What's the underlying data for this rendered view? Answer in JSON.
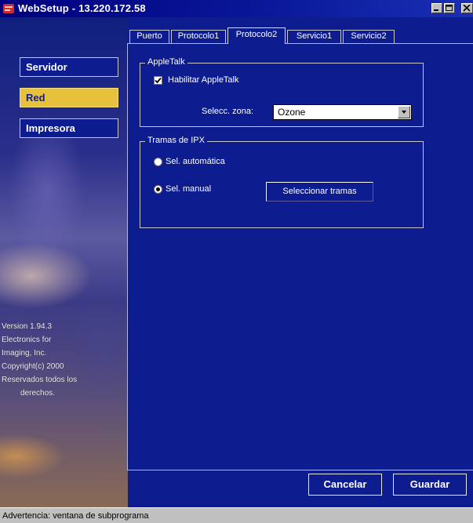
{
  "window": {
    "title": "WebSetup - 13.220.172.58",
    "controls": [
      "minimize-icon",
      "maximize-icon",
      "close-icon"
    ]
  },
  "sidebar": {
    "items": [
      {
        "label": "Servidor",
        "active": false
      },
      {
        "label": "Red",
        "active": true
      },
      {
        "label": "Impresora",
        "active": false
      }
    ],
    "version_lines": [
      "Version 1.94.3",
      "Electronics for",
      "Imaging, Inc.",
      "Copyright(c) 2000",
      "Reservados todos los",
      "derechos."
    ]
  },
  "tabs": [
    {
      "label": "Puerto",
      "active": false
    },
    {
      "label": "Protocolo1",
      "active": false
    },
    {
      "label": "Protocolo2",
      "active": true
    },
    {
      "label": "Servicio1",
      "active": false
    },
    {
      "label": "Servicio2",
      "active": false
    }
  ],
  "appletalk": {
    "group_title": "AppleTalk",
    "enable_label": "Habilitar AppleTalk",
    "enable_checked": true,
    "zone_label": "Selecc. zona:",
    "zone_value": "Ozone"
  },
  "ipx": {
    "group_title": "Tramas de IPX",
    "auto_label": "Sel. automática",
    "manual_label": "Sel. manual",
    "selected": "manual",
    "select_frames_button": "Seleccionar tramas"
  },
  "footer": {
    "cancel_label": "Cancelar",
    "save_label": "Guardar"
  },
  "status_bar": {
    "text": "Advertencia: ventana de subprograma"
  },
  "colors": {
    "panel_bg": "#0d1c8e",
    "active_nav": "#e8c13c",
    "title_bar": "#000080"
  }
}
